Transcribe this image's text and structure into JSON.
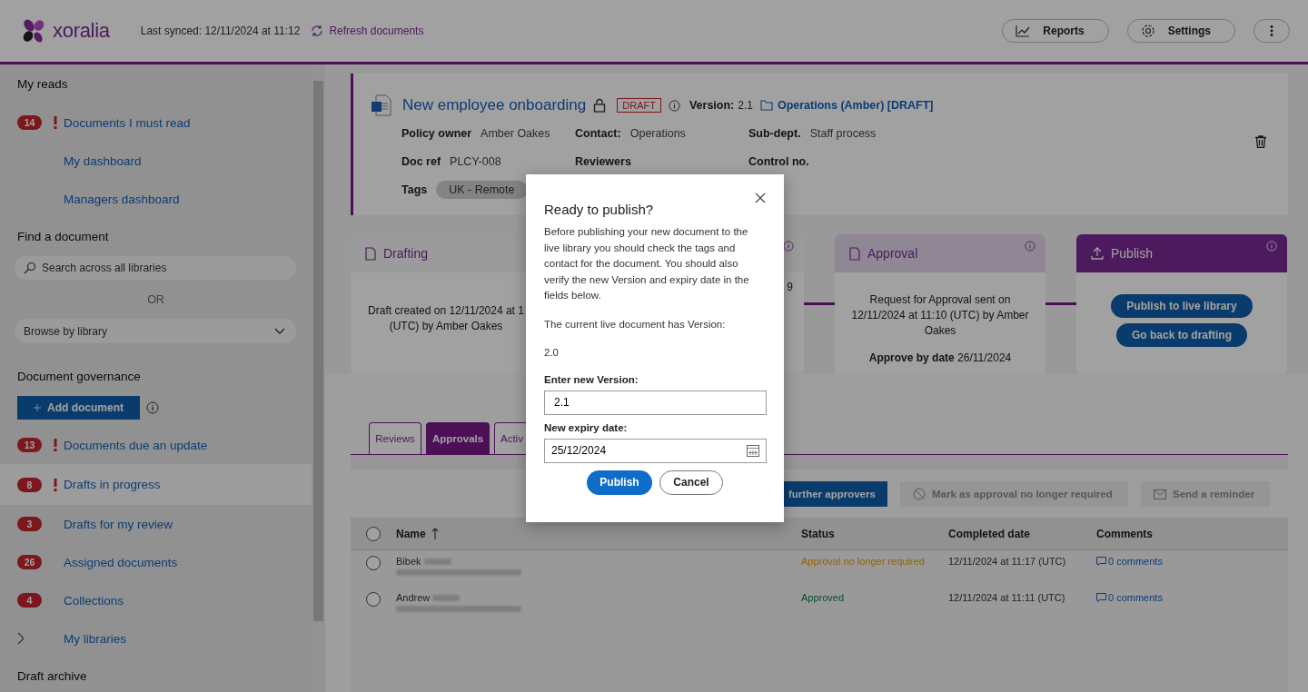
{
  "header": {
    "brand": "xoralia",
    "last_synced": "Last synced: 12/11/2024 at 11:12",
    "refresh": "Refresh documents",
    "buttons": [
      {
        "kind": "reports",
        "label": "Reports"
      },
      {
        "kind": "settings",
        "label": "Settings"
      },
      {
        "kind": "more"
      }
    ]
  },
  "sidebar": {
    "items": [
      {
        "kind": "heading",
        "label": "My reads"
      },
      {
        "kind": "nav",
        "label": "Documents I must read",
        "count": "14",
        "alert": true,
        "selected": false
      },
      {
        "kind": "nav",
        "label": "My dashboard",
        "alert": false,
        "selected": false
      },
      {
        "kind": "nav",
        "label": "Managers dashboard",
        "alert": false,
        "selected": false
      },
      {
        "kind": "heading",
        "label": "Find a document"
      },
      {
        "kind": "search",
        "placeholder": "Search across all libraries"
      },
      {
        "kind": "or",
        "label": "OR"
      },
      {
        "kind": "dropdown",
        "label": "Browse by library"
      },
      {
        "kind": "heading",
        "label": "Document governance"
      },
      {
        "kind": "add",
        "label": "Add document"
      },
      {
        "kind": "nav",
        "label": "Documents due an update",
        "count": "13",
        "alert": true,
        "selected": false
      },
      {
        "kind": "nav",
        "label": "Drafts in progress",
        "count": "8",
        "alert": true,
        "selected": true
      },
      {
        "kind": "nav",
        "label": "Drafts for my review",
        "count": "3",
        "alert": false,
        "selected": false
      },
      {
        "kind": "nav",
        "label": "Assigned documents",
        "count": "26",
        "alert": false,
        "selected": false
      },
      {
        "kind": "nav",
        "label": "Collections",
        "count": "4",
        "alert": false,
        "selected": false
      },
      {
        "kind": "expander",
        "label": "My libraries",
        "expanded": false
      },
      {
        "kind": "heading",
        "label": "Draft archive"
      }
    ]
  },
  "document": {
    "title": "New employee onboarding",
    "locked": true,
    "status": "DRAFT",
    "version_label": "Version:",
    "version": "2.1",
    "location": "Operations (Amber) [DRAFT]",
    "fields": [
      {
        "label": "Policy owner",
        "value": "Amber Oakes"
      },
      {
        "label": "Contact:",
        "value": "Operations"
      },
      {
        "label": "Sub-dept.",
        "value": "Staff process"
      },
      {
        "label": "Doc ref",
        "value": "PLCY-008"
      },
      {
        "label": "Reviewers"
      },
      {
        "label": "Control no."
      }
    ],
    "tags_label": "Tags",
    "tags": [
      "UK - Remote"
    ]
  },
  "stages": [
    {
      "kind": "drafting",
      "name": "Drafting",
      "active": false,
      "previous": false,
      "lines": [
        "Draft created on 12/11/2024 at 1",
        "(UTC) by Amber Oakes"
      ]
    },
    {
      "kind": "hidden",
      "active": false,
      "previous": false,
      "lines": [
        "9"
      ]
    },
    {
      "kind": "approval",
      "name": "Approval",
      "active": false,
      "previous": true,
      "lines": [
        "Request for Approval sent on",
        "12/11/2024 at 11:10 (UTC) by Amber",
        "Oakes"
      ],
      "due": "**Approve by date** 26/11/2024"
    },
    {
      "kind": "publish",
      "name": "Publish",
      "active": true,
      "previous": false,
      "buttons": [
        "Publish to live library",
        "Go back to drafting"
      ]
    }
  ],
  "tabs": [
    {
      "label": "Reviews",
      "selected": false
    },
    {
      "label": "Approvals",
      "selected": true
    },
    {
      "label": "Activ",
      "selected": false
    }
  ],
  "toolbar": [
    {
      "kind": "add",
      "label": "further approvers",
      "disabled": false
    },
    {
      "kind": "not-required",
      "label": "Mark as approval no longer required",
      "disabled": true
    },
    {
      "kind": "reminder",
      "label": "Send a reminder",
      "disabled": true
    }
  ],
  "table": {
    "all_selected": false,
    "columns": [
      "Name",
      "Status",
      "Completed date",
      "Comments"
    ],
    "rows": [
      {
        "name": "Bibek",
        "status": "Approval no longer required",
        "kind": "not_required",
        "completed": "12/11/2024 at 11:17 (UTC)",
        "comments": "0 comments",
        "selected": false
      },
      {
        "name": "Andrew",
        "status": "Approved",
        "kind": "approved",
        "completed": "12/11/2024 at 11:11 (UTC)",
        "comments": "0 comments",
        "selected": false
      }
    ]
  },
  "modal": {
    "title": "Ready to publish?",
    "text": "Before publishing your new document to the live library you should check the tags and contact for the document. You should also verify the new Version and expiry date in the fields below.",
    "current_label": "The current live document has Version:",
    "current_value": "2.0",
    "version_label": "Enter new Version:",
    "version_value": "2.1",
    "expiry_label": "New expiry date:",
    "expiry_value": "25/12/2024",
    "buttons": [
      {
        "kind": "primary",
        "label": "Publish"
      },
      {
        "kind": "secondary",
        "label": "Cancel"
      }
    ]
  }
}
